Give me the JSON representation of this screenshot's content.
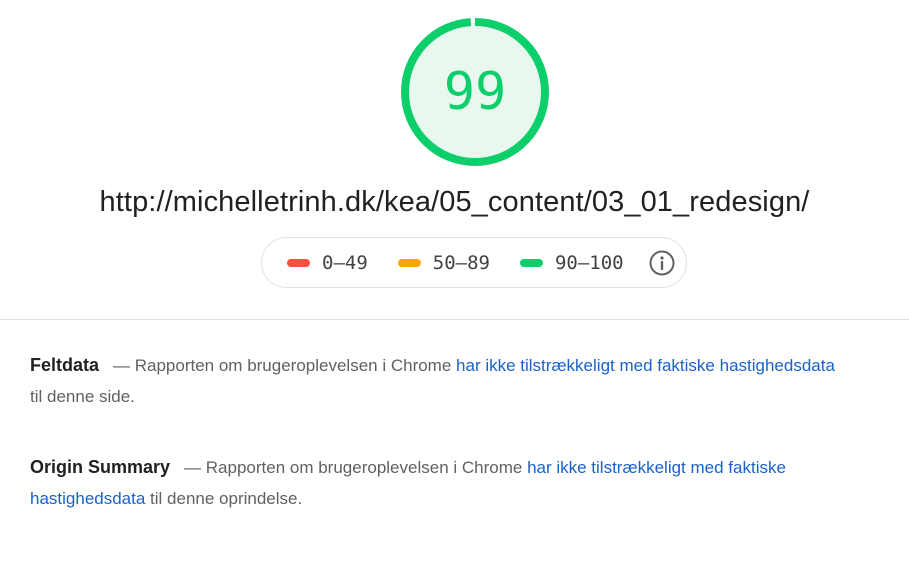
{
  "score": {
    "value": "99",
    "level": 0.99,
    "color": "#0cce6b",
    "fill_color": "#e8f8ee"
  },
  "url": "http://michelletrinh.dk/kea/05_content/03_01_redesign/",
  "legend": {
    "items": [
      {
        "label": "0–49",
        "color": "#ff4e42"
      },
      {
        "label": "50–89",
        "color": "#ffa400"
      },
      {
        "label": "90–100",
        "color": "#0cce6b"
      }
    ],
    "info_icon": "info-circle-icon"
  },
  "sections": [
    {
      "title": "Feltdata",
      "dash": "—",
      "text_before": " Rapporten om brugeroplevelsen i Chrome ",
      "link_text": "har ikke tilstrækkeligt med faktiske hastighedsdata",
      "text_after": " til denne side."
    },
    {
      "title": "Origin Summary",
      "dash": "—",
      "text_before": " Rapporten om brugeroplevelsen i Chrome ",
      "link_text": "har ikke tilstrækkeligt med faktiske hastighedsdata",
      "text_after": " til denne oprindelse."
    }
  ]
}
